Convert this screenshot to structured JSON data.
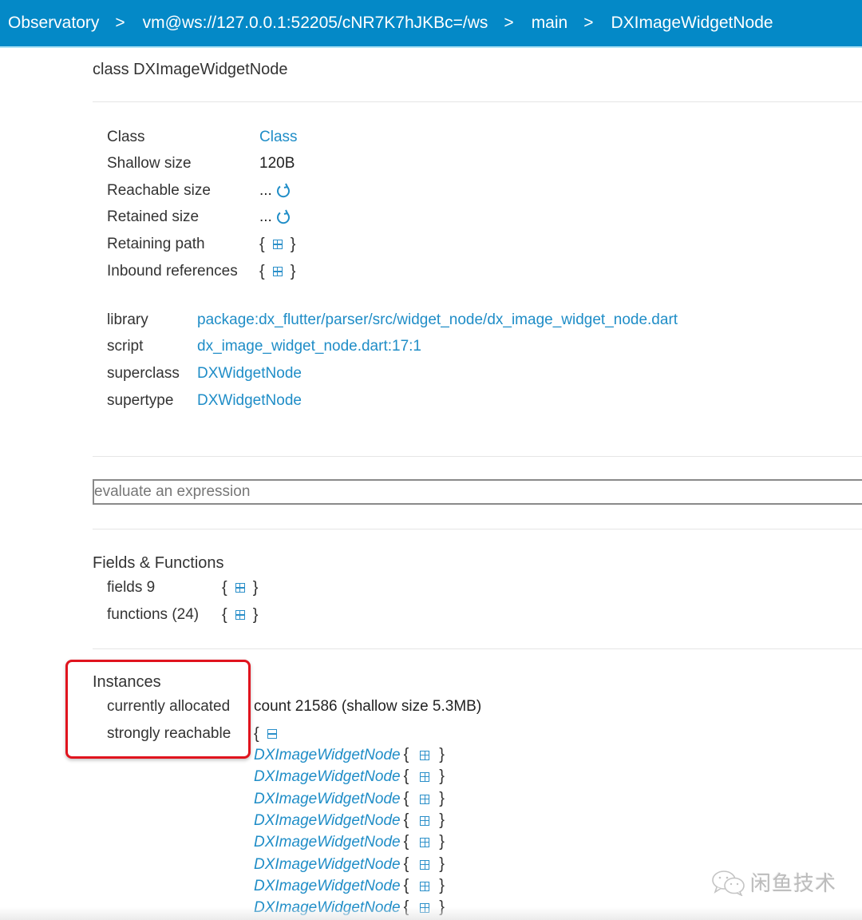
{
  "colors": {
    "navbar": "#0489c7",
    "link": "#1f8dc7",
    "highlight": "#e0141e"
  },
  "breadcrumb": {
    "separator": ">",
    "items": [
      {
        "label": "Observatory"
      },
      {
        "label": "vm@ws://127.0.0.1:52205/cNR7K7hJKBc=/ws"
      },
      {
        "label": "main"
      },
      {
        "label": "DXImageWidgetNode"
      }
    ]
  },
  "page": {
    "title": "class DXImageWidgetNode"
  },
  "object_info": {
    "class_label": "Class",
    "class_value": "Class",
    "shallow_size_label": "Shallow size",
    "shallow_size_value": "120B",
    "reachable_size_label": "Reachable size",
    "reachable_size_value": "...",
    "retained_size_label": "Retained size",
    "retained_size_value": "...",
    "retaining_path_label": "Retaining path",
    "inbound_references_label": "Inbound references",
    "brace_open": "{",
    "brace_close": "}"
  },
  "class_info": {
    "library_label": "library",
    "library_value": "package:dx_flutter/parser/src/widget_node/dx_image_widget_node.dart",
    "script_label": "script",
    "script_value": "dx_image_widget_node.dart:17:1",
    "superclass_label": "superclass",
    "superclass_value": "DXWidgetNode",
    "supertype_label": "supertype",
    "supertype_value": "DXWidgetNode"
  },
  "eval": {
    "placeholder": "evaluate an expression",
    "value": ""
  },
  "fields_functions": {
    "title": "Fields & Functions",
    "fields_label": "fields 9",
    "functions_label": "functions (24)"
  },
  "instances": {
    "title": "Instances",
    "currently_allocated_label": "currently allocated",
    "currently_allocated_value": "count 21586 (shallow size 5.3MB)",
    "strongly_reachable_label": "strongly reachable",
    "items": [
      {
        "label": "DXImageWidgetNode"
      },
      {
        "label": "DXImageWidgetNode"
      },
      {
        "label": "DXImageWidgetNode"
      },
      {
        "label": "DXImageWidgetNode"
      },
      {
        "label": "DXImageWidgetNode"
      },
      {
        "label": "DXImageWidgetNode"
      },
      {
        "label": "DXImageWidgetNode"
      },
      {
        "label": "DXImageWidgetNode"
      }
    ]
  },
  "watermark": {
    "text": "闲鱼技术",
    "icon": "wechat-icon"
  }
}
